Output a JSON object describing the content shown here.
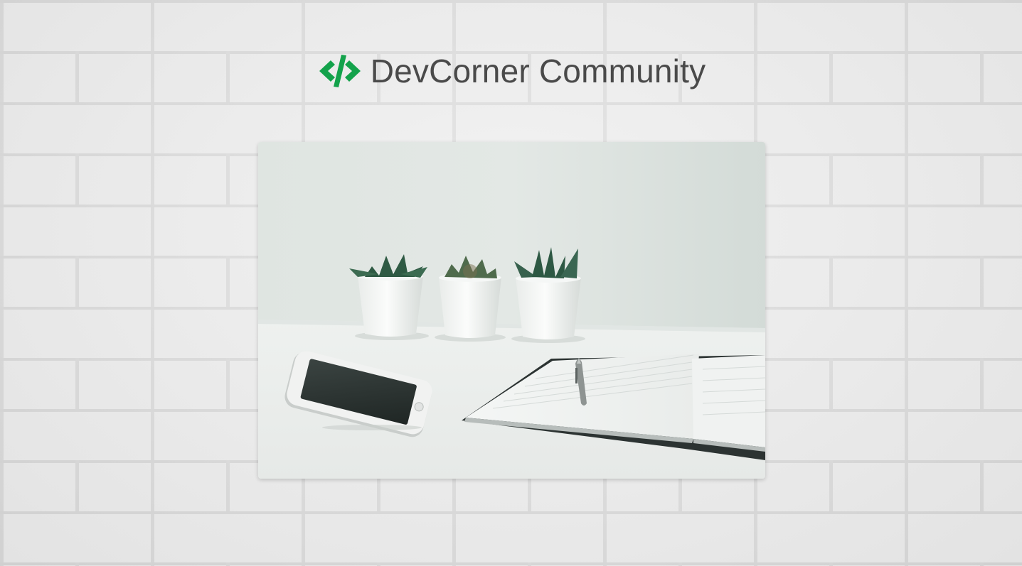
{
  "brand": {
    "logo_icon": "code-slash-icon",
    "title": "DevCorner Community",
    "accent_color": "#13a24b"
  },
  "hero": {
    "image": "workspace-photo",
    "subjects": [
      "three potted succulents",
      "smartphone",
      "open notebook with pen"
    ]
  },
  "background": {
    "texture": "white-brick-wall",
    "color": "#ececec"
  }
}
